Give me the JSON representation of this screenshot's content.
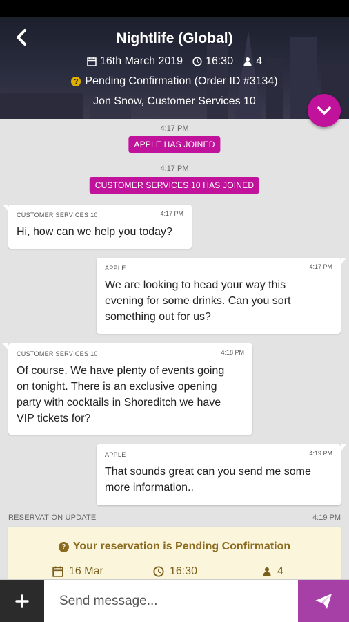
{
  "header": {
    "title": "Nightlife (Global)",
    "date": "16th March 2019",
    "time": "16:30",
    "guests": "4",
    "status": "Pending Confirmation (Order ID #3134)",
    "participants": "Jon Snow,  Customer Services 10"
  },
  "system": [
    {
      "time": "4:17 PM",
      "text": "APPLE HAS JOINED"
    },
    {
      "time": "4:17 PM",
      "text": "CUSTOMER SERVICES 10 HAS JOINED"
    }
  ],
  "messages": [
    {
      "sender": "CUSTOMER SERVICES 10",
      "time": "4:17 PM",
      "lines": [
        "Hi, how can we help you today?"
      ]
    },
    {
      "sender": "APPLE",
      "time": "4:17 PM",
      "lines": [
        "We are looking to head your way this",
        "evening for some drinks. Can you sort",
        "something out for us?"
      ]
    },
    {
      "sender": "CUSTOMER SERVICES 10",
      "time": "4:18 PM",
      "lines": [
        "Of course. We have plenty of events going",
        "on tonight. There is an exclusive opening",
        "party with cocktails in Shoreditch we have",
        "VIP tickets for?"
      ]
    },
    {
      "sender": "APPLE",
      "time": "4:19 PM",
      "lines": [
        "That sounds great can you send me some",
        "more information.."
      ]
    }
  ],
  "reservation": {
    "label": "RESERVATION UPDATE",
    "time": "4:19 PM",
    "title": "Your reservation is Pending Confirmation",
    "date": "16 Mar",
    "clock": "16:30",
    "guests": "4"
  },
  "composer": {
    "placeholder": "Send message..."
  },
  "colors": {
    "accent": "#c0129a",
    "send": "#a640a6",
    "reservation_bg": "#fbf5dc",
    "reservation_text": "#8a6b1f"
  },
  "icons": [
    "back-arrow-icon",
    "calendar-icon",
    "clock-icon",
    "person-icon",
    "question-icon",
    "chevron-down-icon",
    "plus-icon",
    "send-icon"
  ]
}
